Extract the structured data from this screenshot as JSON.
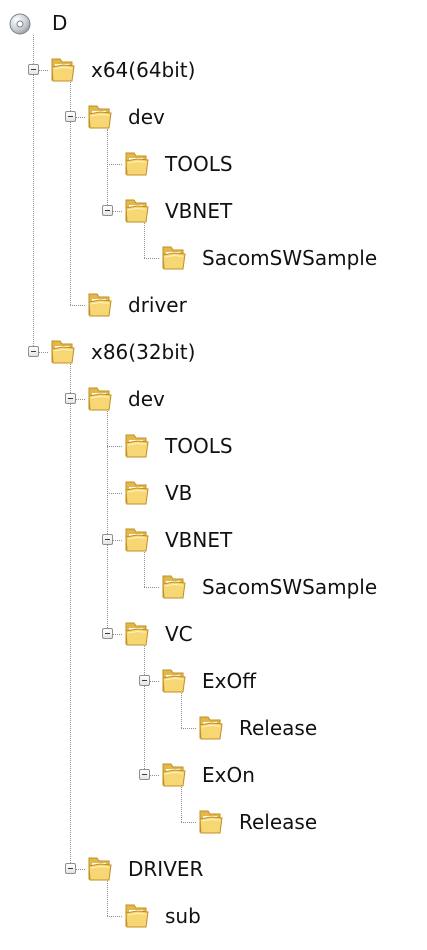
{
  "tree": {
    "root": {
      "label": "D",
      "icon": "disc-drive-icon"
    },
    "nodes": [
      {
        "id": "x64",
        "label": "x64(64bit)",
        "depth": 1,
        "expanded": true,
        "icon": "folder-icon"
      },
      {
        "id": "x64-dev",
        "label": "dev",
        "depth": 2,
        "expanded": true,
        "icon": "folder-icon"
      },
      {
        "id": "x64-dev-tools",
        "label": "TOOLS",
        "depth": 3,
        "icon": "folder-icon"
      },
      {
        "id": "x64-dev-vbnet",
        "label": "VBNET",
        "depth": 3,
        "expanded": true,
        "icon": "folder-icon"
      },
      {
        "id": "x64-dev-vbnet-sample",
        "label": "SacomSWSample",
        "depth": 4,
        "icon": "folder-icon"
      },
      {
        "id": "x64-driver",
        "label": "driver",
        "depth": 2,
        "icon": "folder-icon"
      },
      {
        "id": "x86",
        "label": "x86(32bit)",
        "depth": 1,
        "expanded": true,
        "icon": "folder-icon"
      },
      {
        "id": "x86-dev",
        "label": "dev",
        "depth": 2,
        "expanded": true,
        "icon": "folder-icon"
      },
      {
        "id": "x86-dev-tools",
        "label": "TOOLS",
        "depth": 3,
        "icon": "folder-icon"
      },
      {
        "id": "x86-dev-vb",
        "label": "VB",
        "depth": 3,
        "icon": "folder-icon"
      },
      {
        "id": "x86-dev-vbnet",
        "label": "VBNET",
        "depth": 3,
        "expanded": true,
        "icon": "folder-icon"
      },
      {
        "id": "x86-dev-vbnet-sample",
        "label": "SacomSWSample",
        "depth": 4,
        "icon": "folder-icon"
      },
      {
        "id": "x86-dev-vc",
        "label": "VC",
        "depth": 3,
        "expanded": true,
        "icon": "folder-icon"
      },
      {
        "id": "x86-dev-vc-exoff",
        "label": "ExOff",
        "depth": 4,
        "expanded": true,
        "icon": "folder-icon"
      },
      {
        "id": "x86-dev-vc-exoff-release",
        "label": "Release",
        "depth": 5,
        "icon": "folder-icon"
      },
      {
        "id": "x86-dev-vc-exon",
        "label": "ExOn",
        "depth": 4,
        "expanded": true,
        "icon": "folder-icon"
      },
      {
        "id": "x86-dev-vc-exon-release",
        "label": "Release",
        "depth": 5,
        "icon": "folder-icon"
      },
      {
        "id": "x86-driver",
        "label": "DRIVER",
        "depth": 2,
        "expanded": true,
        "icon": "folder-icon"
      },
      {
        "id": "x86-driver-sub",
        "label": "sub",
        "depth": 3,
        "icon": "folder-icon"
      }
    ]
  },
  "colors": {
    "connector": "#8d8d8d",
    "folder_back": "#e3b84a",
    "folder_front": "#f7d774",
    "folder_edge": "#c08f23",
    "text": "#111111"
  }
}
